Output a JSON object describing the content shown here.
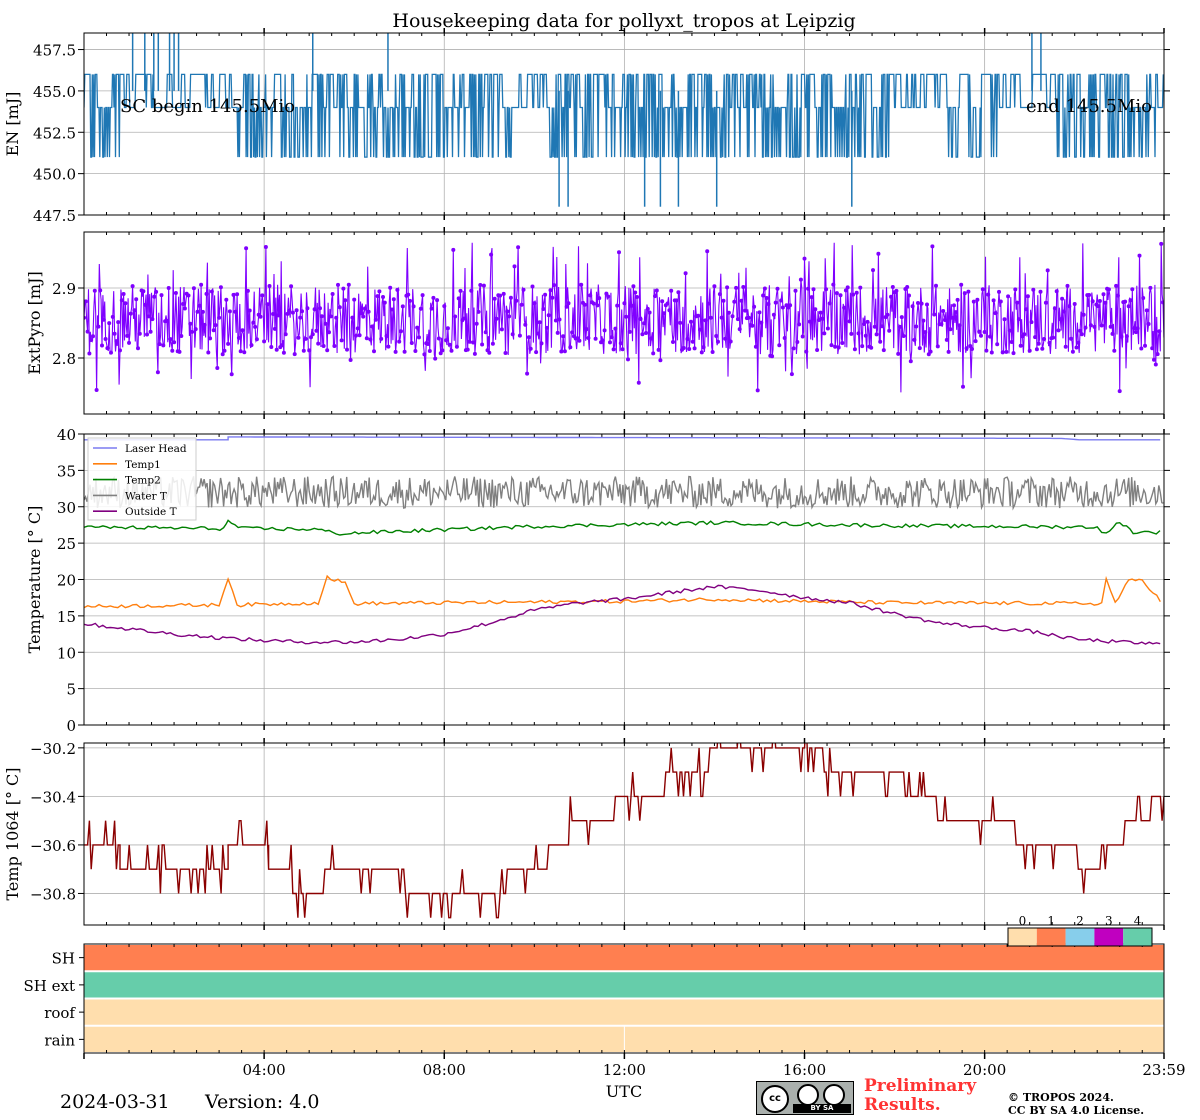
{
  "title": "Housekeeping data for pollyxt_tropos at Leipzig",
  "chart_data": [
    {
      "type": "line",
      "panel": "energy",
      "ylabel": "EN [mJ]",
      "ylim": [
        447.5,
        458.5
      ],
      "yticks": [
        447.5,
        450.0,
        452.5,
        455.0,
        457.5
      ],
      "yticklabels": [
        "447.5",
        "450.0",
        "452.5",
        "455.0",
        "457.5"
      ],
      "grid": true,
      "color": "#1f77b4",
      "baseline_levels": [
        454,
        456
      ],
      "spike_highs": [
        [
          1.08,
          459
        ],
        [
          1.35,
          459
        ],
        [
          1.55,
          459
        ],
        [
          1.65,
          459
        ],
        [
          1.9,
          459
        ],
        [
          2.0,
          459
        ],
        [
          2.1,
          459
        ],
        [
          5.08,
          459
        ],
        [
          6.75,
          459
        ],
        [
          21.05,
          459
        ],
        [
          21.25,
          459
        ]
      ],
      "spike_lows": [
        [
          10.55,
          448
        ],
        [
          10.75,
          448
        ],
        [
          12.45,
          448
        ],
        [
          12.8,
          448
        ],
        [
          13.2,
          448
        ],
        [
          14.05,
          448
        ],
        [
          17.05,
          448
        ]
      ],
      "dense_low_ranges": [
        [
          0.15,
          0.8,
          451
        ],
        [
          3.3,
          9.5,
          451
        ],
        [
          10.3,
          18.0,
          451
        ],
        [
          19.2,
          20.3,
          451
        ],
        [
          21.6,
          23.9,
          451
        ]
      ],
      "annotations": [
        "SC begin 145.5Mio",
        "end 145.5Mio"
      ]
    },
    {
      "type": "scatter",
      "panel": "extpyro",
      "ylabel": "ExtPyro [mJ]",
      "ylim": [
        2.72,
        2.98
      ],
      "yticks": [
        2.8,
        2.9
      ],
      "yticklabels": [
        "2.8",
        "2.9"
      ],
      "grid": true,
      "color": "#7f00ff",
      "mean": 2.855,
      "spread": 0.05,
      "x": [
        0,
        24
      ]
    },
    {
      "type": "line",
      "panel": "temperature",
      "ylabel": "Temperature [$^\\circ C$]",
      "ylim": [
        0,
        40
      ],
      "yticks": [
        0,
        5,
        10,
        15,
        20,
        25,
        30,
        35,
        40
      ],
      "yticklabels": [
        "0",
        "5",
        "10",
        "15",
        "20",
        "25",
        "30",
        "35",
        "40"
      ],
      "grid": true,
      "legend": "top-left",
      "series": [
        {
          "name": "Laser Head",
          "color": "#7b7bf0",
          "x": [
            0,
            3.2,
            3.2,
            21.7,
            22.1,
            23.98
          ],
          "values": [
            39.2,
            39.2,
            39.6,
            39.4,
            39.2,
            39.2
          ]
        },
        {
          "name": "Temp1",
          "color": "#ff7f0e",
          "x": [
            0,
            3.0,
            3.2,
            3.4,
            5.2,
            5.4,
            5.8,
            6.0,
            12.0,
            14.0,
            16.0,
            18.0,
            22.6,
            22.7,
            22.9,
            23.2,
            23.5,
            23.98
          ],
          "values": [
            16.3,
            16.5,
            20.3,
            16.5,
            16.8,
            20.3,
            19.5,
            16.7,
            17.0,
            17.3,
            17.0,
            16.8,
            16.7,
            20.1,
            16.8,
            19.8,
            20.0,
            16.5
          ]
        },
        {
          "name": "Temp2",
          "color": "#008000",
          "x": [
            0,
            3.1,
            3.2,
            3.5,
            5.2,
            5.6,
            10.0,
            14.0,
            18.0,
            22.5,
            22.7,
            23.0,
            23.3,
            23.98
          ],
          "values": [
            27.2,
            27.0,
            28.0,
            27.0,
            26.9,
            26.3,
            27.3,
            27.8,
            27.4,
            27.2,
            26.2,
            28.0,
            26.5,
            26.5
          ]
        },
        {
          "name": "Water T",
          "color": "#808080",
          "mean": 32.0,
          "spread": 2.2
        },
        {
          "name": "Outside T",
          "color": "#800080",
          "x": [
            0,
            1,
            2,
            3,
            4,
            5,
            6,
            7,
            8,
            9,
            10,
            11,
            12,
            13,
            14,
            15,
            16,
            17,
            18,
            19,
            20,
            21,
            22,
            23,
            23.98
          ],
          "values": [
            13.9,
            13.2,
            12.5,
            12.0,
            11.6,
            11.4,
            11.4,
            11.8,
            12.5,
            14.0,
            15.8,
            16.8,
            17.3,
            18.2,
            19.0,
            18.5,
            17.5,
            16.8,
            15.3,
            14.0,
            13.4,
            12.9,
            11.8,
            11.4,
            11.1
          ]
        }
      ]
    },
    {
      "type": "line",
      "panel": "temp1064",
      "ylabel": "Temp 1064 [$^\\circ C$]",
      "ylim": [
        -30.93,
        -30.18
      ],
      "yticks": [
        -30.8,
        -30.6,
        -30.4,
        -30.2
      ],
      "yticklabels": [
        "−30.8",
        "−30.6",
        "−30.4",
        "−30.2"
      ],
      "grid": true,
      "color": "#8b0000",
      "x": [
        0,
        0.8,
        0.8,
        1.9,
        2.3,
        3.2,
        3.2,
        4.1,
        4.1,
        4.6,
        4.9,
        5.8,
        6.0,
        6.9,
        7.3,
        8.3,
        8.4,
        9.0,
        9.4,
        10.0,
        10.6,
        11.0,
        11.8,
        12.3,
        12.6,
        13.2,
        13.5,
        14.3,
        15.0,
        16.0,
        16.4,
        17.0,
        17.8,
        18.6,
        19.2,
        20.3,
        21.1,
        21.6,
        22.4,
        22.8,
        23.4,
        23.98
      ],
      "values": [
        -30.6,
        -30.6,
        -30.7,
        -30.7,
        -30.7,
        -30.7,
        -30.6,
        -30.6,
        -30.7,
        -30.75,
        -30.8,
        -30.7,
        -30.7,
        -30.7,
        -30.8,
        -30.8,
        -30.85,
        -30.8,
        -30.75,
        -30.7,
        -30.6,
        -30.5,
        -30.45,
        -30.4,
        -30.4,
        -30.3,
        -30.3,
        -30.2,
        -30.2,
        -30.2,
        -30.25,
        -30.3,
        -30.3,
        -30.4,
        -30.5,
        -30.5,
        -30.6,
        -30.6,
        -30.7,
        -30.6,
        -30.5,
        -30.4
      ]
    },
    {
      "type": "heatmap",
      "panel": "status",
      "rows": [
        "SH",
        "SH ext",
        "roof",
        "rain"
      ],
      "values": [
        1,
        4,
        0,
        0
      ],
      "colorbar_ticks": [
        "0",
        "1",
        "2",
        "3",
        "4"
      ],
      "colors": [
        "#ffdead",
        "#ff7f50",
        "#87ceeb",
        "#c000c0",
        "#66cdaa"
      ]
    }
  ],
  "x_axis": {
    "label": "UTC",
    "range": [
      0,
      23.983
    ],
    "ticks": [
      4,
      8,
      12,
      16,
      20,
      23.983
    ],
    "ticklabels": [
      "04:00",
      "08:00",
      "12:00",
      "16:00",
      "20:00",
      "23:59"
    ]
  },
  "footer": {
    "date": "2024-03-31",
    "version": "Version: 4.0",
    "preliminary": "Preliminary\nResults.",
    "copyright": "© TROPOS 2024.\nCC BY SA 4.0 License.",
    "cc_badge": "BY  SA"
  }
}
